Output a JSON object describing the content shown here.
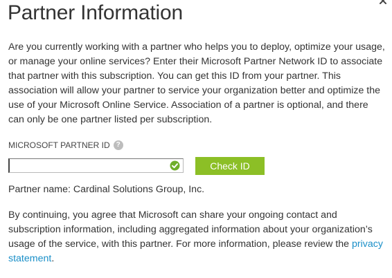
{
  "dialog": {
    "title": "Partner Information",
    "close_icon": "close-icon",
    "intro_text": "Are you currently working with a partner who helps you to deploy, optimize your usage, or manage your online services? Enter their Microsoft Partner Network ID to associate that partner with this subscription. You can get this ID from your partner. This association will allow your partner to service your organization better and optimize the use of your Microsoft Online Service. Association of a partner is optional, and there can only be one partner listed per subscription."
  },
  "partner_id": {
    "label": "MICROSOFT PARTNER ID",
    "help_icon": "help-icon",
    "help_glyph": "?",
    "value": "",
    "status_icon": "check-circle-icon",
    "status_color": "#6fae2b"
  },
  "actions": {
    "check_id_label": "Check ID",
    "check_id_color": "#8cbf26"
  },
  "partner_name": {
    "text": "Partner name: Cardinal Solutions Group, Inc."
  },
  "consent": {
    "text": "By continuing, you agree that Microsoft can share your ongoing contact and subscription information, including aggregated information about your organization’s usage of the service, with this partner. For more information, please review the ",
    "link_label": "privacy statement",
    "trailing": ".",
    "link_color": "#1a8fc8"
  }
}
